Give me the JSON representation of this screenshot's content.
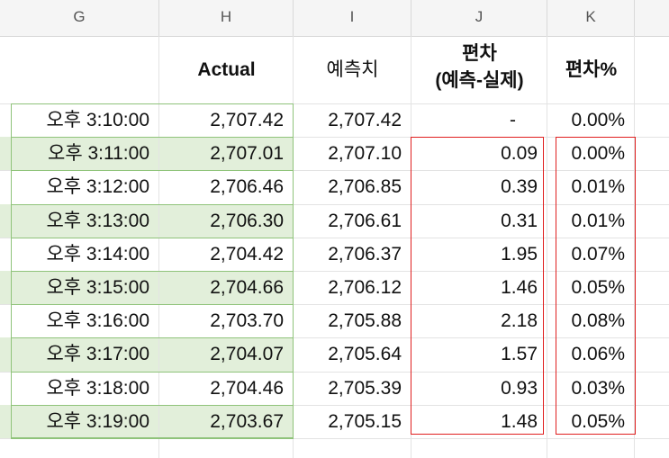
{
  "columns": [
    "G",
    "H",
    "I",
    "J",
    "K"
  ],
  "headers": {
    "h": "Actual",
    "i": "예측치",
    "j_line1": "편차",
    "j_line2": "(예측-실제)",
    "k": "편차%"
  },
  "rows": [
    {
      "time": "오후 3:10:00",
      "actual": "2,707.42",
      "forecast": "2,707.42",
      "diff": "-",
      "pct": "0.00%",
      "highlight": false
    },
    {
      "time": "오후 3:11:00",
      "actual": "2,707.01",
      "forecast": "2,707.10",
      "diff": "0.09",
      "pct": "0.00%",
      "highlight": true
    },
    {
      "time": "오후 3:12:00",
      "actual": "2,706.46",
      "forecast": "2,706.85",
      "diff": "0.39",
      "pct": "0.01%",
      "highlight": false
    },
    {
      "time": "오후 3:13:00",
      "actual": "2,706.30",
      "forecast": "2,706.61",
      "diff": "0.31",
      "pct": "0.01%",
      "highlight": true
    },
    {
      "time": "오후 3:14:00",
      "actual": "2,704.42",
      "forecast": "2,706.37",
      "diff": "1.95",
      "pct": "0.07%",
      "highlight": false
    },
    {
      "time": "오후 3:15:00",
      "actual": "2,704.66",
      "forecast": "2,706.12",
      "diff": "1.46",
      "pct": "0.05%",
      "highlight": true
    },
    {
      "time": "오후 3:16:00",
      "actual": "2,703.70",
      "forecast": "2,705.88",
      "diff": "2.18",
      "pct": "0.08%",
      "highlight": false
    },
    {
      "time": "오후 3:17:00",
      "actual": "2,704.07",
      "forecast": "2,705.64",
      "diff": "1.57",
      "pct": "0.06%",
      "highlight": true
    },
    {
      "time": "오후 3:18:00",
      "actual": "2,704.46",
      "forecast": "2,705.39",
      "diff": "0.93",
      "pct": "0.03%",
      "highlight": false
    },
    {
      "time": "오후 3:19:00",
      "actual": "2,703.67",
      "forecast": "2,705.15",
      "diff": "1.48",
      "pct": "0.05%",
      "highlight": true
    }
  ],
  "colors": {
    "highlight_fill": "#e2efda",
    "highlight_border": "#8fc37a",
    "annotation_box": "#e02020",
    "grid": "#e3e3e3"
  }
}
